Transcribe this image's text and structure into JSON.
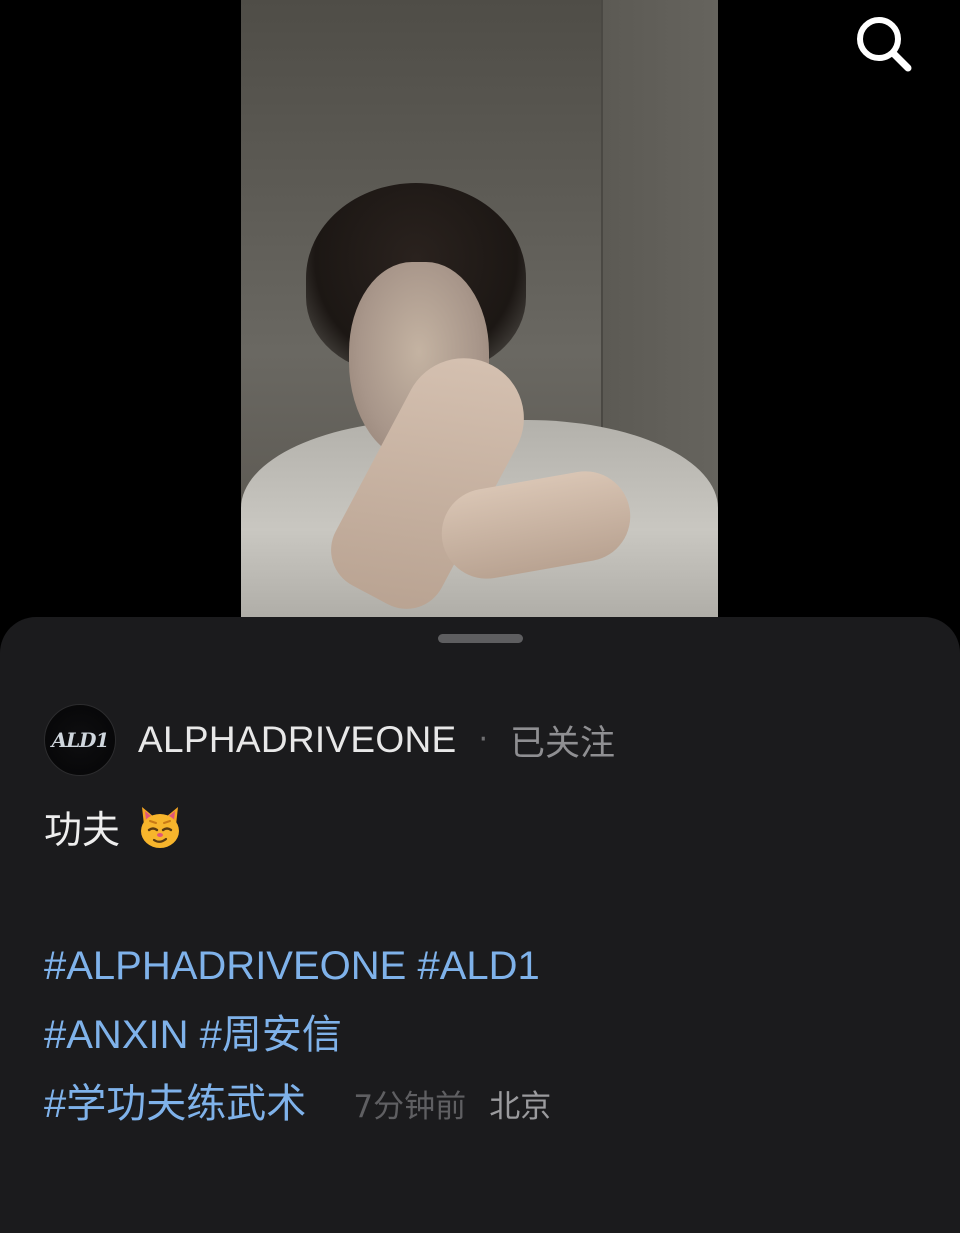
{
  "search": {
    "icon": "search-icon"
  },
  "author": {
    "avatar_text": "ALD1",
    "name": "ALPHADRIVEONE",
    "separator": "·",
    "follow_status": "已关注"
  },
  "post": {
    "caption": "功夫",
    "emoji": "cat-emoji",
    "hashtags_line1": [
      "#ALPHADRIVEONE",
      "#ALD1"
    ],
    "hashtags_line2": [
      "#ANXIN",
      "#周安信"
    ],
    "hashtags_line3": [
      "#学功夫练武术"
    ],
    "time_ago": "7分钟前",
    "location": "北京"
  },
  "colors": {
    "sheet_bg": "#1b1b1d",
    "hashtag": "#7fb2ea",
    "muted": "#5f5f62"
  }
}
